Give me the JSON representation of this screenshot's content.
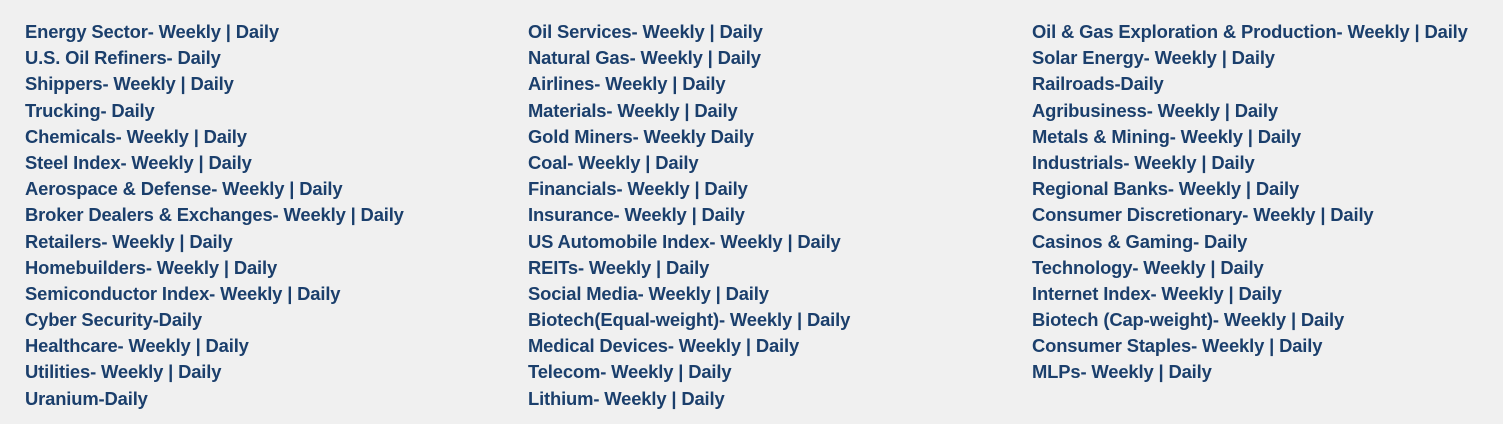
{
  "columns": [
    {
      "items": [
        "Energy Sector- Weekly | Daily",
        "U.S. Oil Refiners- Daily",
        "Shippers- Weekly | Daily",
        "Trucking- Daily",
        "Chemicals- Weekly | Daily",
        "Steel Index- Weekly | Daily",
        "Aerospace & Defense- Weekly | Daily",
        "Broker Dealers & Exchanges- Weekly | Daily",
        "Retailers- Weekly | Daily",
        "Homebuilders- Weekly | Daily",
        "Semiconductor Index- Weekly | Daily",
        "Cyber Security-Daily",
        "Healthcare- Weekly | Daily",
        "Utilities- Weekly | Daily",
        "Uranium-Daily"
      ]
    },
    {
      "items": [
        "Oil Services- Weekly | Daily",
        "Natural Gas- Weekly | Daily",
        "Airlines- Weekly | Daily",
        "Materials- Weekly | Daily",
        "Gold Miners- Weekly   Daily",
        "Coal- Weekly | Daily",
        "Financials- Weekly | Daily",
        "Insurance- Weekly | Daily",
        "US Automobile Index- Weekly | Daily",
        "REITs- Weekly | Daily",
        "Social Media- Weekly | Daily",
        "Biotech(Equal-weight)- Weekly | Daily",
        "Medical Devices- Weekly | Daily",
        "Telecom- Weekly | Daily",
        "Lithium- Weekly | Daily"
      ]
    },
    {
      "items": [
        "Oil & Gas Exploration & Production- Weekly | Daily",
        "Solar Energy- Weekly | Daily",
        "Railroads-Daily",
        "Agribusiness- Weekly | Daily",
        "Metals & Mining- Weekly | Daily",
        "Industrials- Weekly | Daily",
        "Regional Banks- Weekly | Daily",
        "Consumer Discretionary- Weekly | Daily",
        "Casinos & Gaming- Daily",
        "Technology- Weekly | Daily",
        "Internet Index- Weekly | Daily",
        "Biotech (Cap-weight)- Weekly | Daily",
        "Consumer Staples- Weekly | Daily",
        "MLPs- Weekly | Daily"
      ]
    }
  ],
  "colors": {
    "background": "#f0f0f0",
    "text": "#1b3f6c"
  }
}
